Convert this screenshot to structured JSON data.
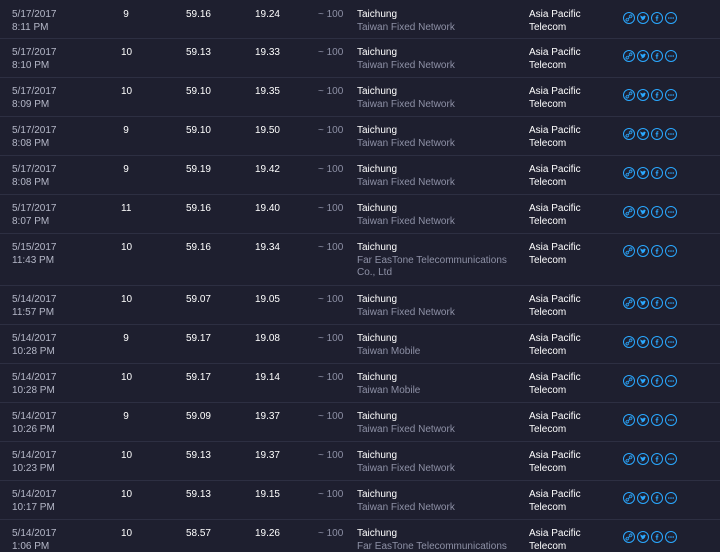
{
  "accent_color": "#2aa8ff",
  "share_icons": [
    "link-icon",
    "twitter-icon",
    "facebook-icon",
    "more-icon"
  ],
  "rows": [
    {
      "date": "5/17/2017",
      "time": "8:11 PM",
      "ping": "9",
      "download": "59.16",
      "upload": "19.24",
      "est": "~ 100",
      "city": "Taichung",
      "isp": "Taiwan Fixed Network",
      "provider": [
        "Asia Pacific",
        "Telecom"
      ]
    },
    {
      "date": "5/17/2017",
      "time": "8:10 PM",
      "ping": "10",
      "download": "59.13",
      "upload": "19.33",
      "est": "~ 100",
      "city": "Taichung",
      "isp": "Taiwan Fixed Network",
      "provider": [
        "Asia Pacific",
        "Telecom"
      ]
    },
    {
      "date": "5/17/2017",
      "time": "8:09 PM",
      "ping": "10",
      "download": "59.10",
      "upload": "19.35",
      "est": "~ 100",
      "city": "Taichung",
      "isp": "Taiwan Fixed Network",
      "provider": [
        "Asia Pacific",
        "Telecom"
      ]
    },
    {
      "date": "5/17/2017",
      "time": "8:08 PM",
      "ping": "9",
      "download": "59.10",
      "upload": "19.50",
      "est": "~ 100",
      "city": "Taichung",
      "isp": "Taiwan Fixed Network",
      "provider": [
        "Asia Pacific",
        "Telecom"
      ]
    },
    {
      "date": "5/17/2017",
      "time": "8:08 PM",
      "ping": "9",
      "download": "59.19",
      "upload": "19.42",
      "est": "~ 100",
      "city": "Taichung",
      "isp": "Taiwan Fixed Network",
      "provider": [
        "Asia Pacific",
        "Telecom"
      ]
    },
    {
      "date": "5/17/2017",
      "time": "8:07 PM",
      "ping": "11",
      "download": "59.16",
      "upload": "19.40",
      "est": "~ 100",
      "city": "Taichung",
      "isp": "Taiwan Fixed Network",
      "provider": [
        "Asia Pacific",
        "Telecom"
      ]
    },
    {
      "date": "5/15/2017",
      "time": "11:43 PM",
      "ping": "10",
      "download": "59.16",
      "upload": "19.34",
      "est": "~ 100",
      "city": "Taichung",
      "isp": "Far EasTone Telecommunications Co., Ltd",
      "provider": [
        "Asia Pacific",
        "Telecom"
      ]
    },
    {
      "date": "5/14/2017",
      "time": "11:57 PM",
      "ping": "10",
      "download": "59.07",
      "upload": "19.05",
      "est": "~ 100",
      "city": "Taichung",
      "isp": "Taiwan Fixed Network",
      "provider": [
        "Asia Pacific",
        "Telecom"
      ]
    },
    {
      "date": "5/14/2017",
      "time": "10:28 PM",
      "ping": "9",
      "download": "59.17",
      "upload": "19.08",
      "est": "~ 100",
      "city": "Taichung",
      "isp": "Taiwan Mobile",
      "provider": [
        "Asia Pacific",
        "Telecom"
      ]
    },
    {
      "date": "5/14/2017",
      "time": "10:28 PM",
      "ping": "10",
      "download": "59.17",
      "upload": "19.14",
      "est": "~ 100",
      "city": "Taichung",
      "isp": "Taiwan Mobile",
      "provider": [
        "Asia Pacific",
        "Telecom"
      ]
    },
    {
      "date": "5/14/2017",
      "time": "10:26 PM",
      "ping": "9",
      "download": "59.09",
      "upload": "19.37",
      "est": "~ 100",
      "city": "Taichung",
      "isp": "Taiwan Fixed Network",
      "provider": [
        "Asia Pacific",
        "Telecom"
      ]
    },
    {
      "date": "5/14/2017",
      "time": "10:23 PM",
      "ping": "10",
      "download": "59.13",
      "upload": "19.37",
      "est": "~ 100",
      "city": "Taichung",
      "isp": "Taiwan Fixed Network",
      "provider": [
        "Asia Pacific",
        "Telecom"
      ]
    },
    {
      "date": "5/14/2017",
      "time": "10:17 PM",
      "ping": "10",
      "download": "59.13",
      "upload": "19.15",
      "est": "~ 100",
      "city": "Taichung",
      "isp": "Taiwan Fixed Network",
      "provider": [
        "Asia Pacific",
        "Telecom"
      ]
    },
    {
      "date": "5/14/2017",
      "time": "1:06 PM",
      "ping": "10",
      "download": "58.57",
      "upload": "19.26",
      "est": "~ 100",
      "city": "Taichung",
      "isp": "Far EasTone Telecommunications",
      "provider": [
        "Asia Pacific",
        "Telecom"
      ]
    }
  ]
}
